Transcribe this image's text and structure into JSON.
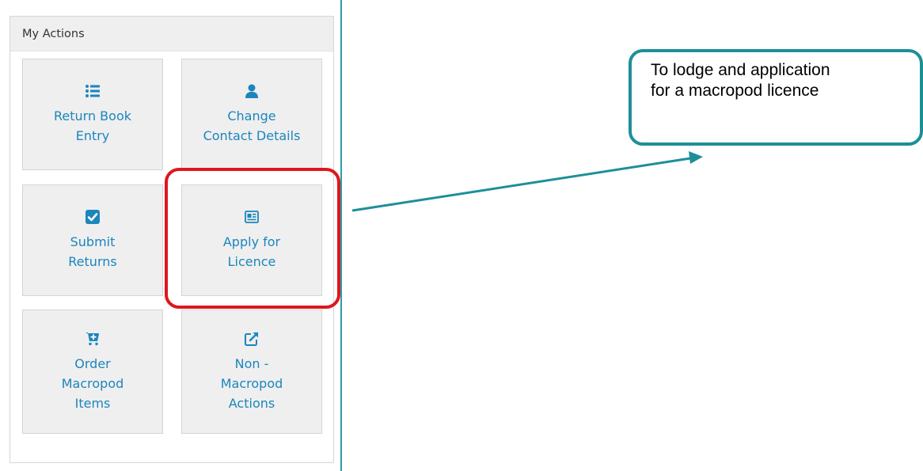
{
  "panel": {
    "title": "My Actions",
    "tiles": [
      {
        "line1": "Return Book",
        "line2": "Entry",
        "line3": "",
        "icon": "list-icon"
      },
      {
        "line1": "Change",
        "line2": "Contact Details",
        "line3": "",
        "icon": "user-icon"
      },
      {
        "line1": "Submit",
        "line2": "Returns",
        "line3": "",
        "icon": "checkbox-icon"
      },
      {
        "line1": "Apply for",
        "line2": "Licence",
        "line3": "",
        "icon": "newspaper-icon"
      },
      {
        "line1": "Order",
        "line2": "Macropod",
        "line3": "Items",
        "icon": "cart-plus-icon"
      },
      {
        "line1": "Non -",
        "line2": "Macropod",
        "line3": "Actions",
        "icon": "external-link-icon"
      }
    ]
  },
  "callout": {
    "line1": "To lodge and application",
    "line2": "for a macropod licence"
  },
  "colors": {
    "link": "#1b86bd",
    "highlight": "#e0161d",
    "callout_border": "#1d8f99",
    "tile_bg": "#efefef"
  }
}
